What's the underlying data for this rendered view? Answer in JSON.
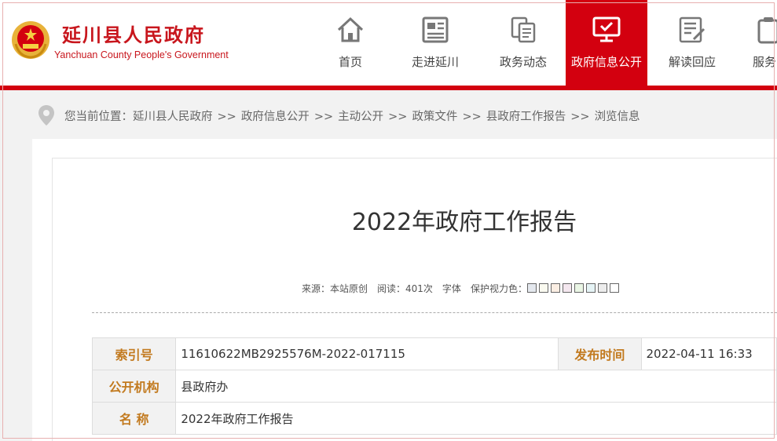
{
  "header": {
    "site_name": "延川县人民政府",
    "site_name_en": "Yanchuan County People's Government"
  },
  "nav": {
    "items": [
      {
        "label": "首页",
        "icon": "home-icon",
        "active": false
      },
      {
        "label": "走进延川",
        "icon": "newspaper-icon",
        "active": false
      },
      {
        "label": "政务动态",
        "icon": "documents-icon",
        "active": false
      },
      {
        "label": "政府信息公开",
        "icon": "monitor-icon",
        "active": true
      },
      {
        "label": "解读回应",
        "icon": "edit-document-icon",
        "active": false
      },
      {
        "label": "服务",
        "icon": "clipboard-icon",
        "active": false
      }
    ]
  },
  "breadcrumb": {
    "prefix": "您当前位置：",
    "items": [
      "延川县人民政府",
      "政府信息公开",
      "主动公开",
      "政策文件",
      "县政府工作报告",
      "浏览信息"
    ],
    "separator": ">>"
  },
  "article": {
    "title": "2022年政府工作报告",
    "meta": {
      "source": "来源：本站原创",
      "views": "阅读：401次",
      "font": "字体",
      "eye_care": "保护视力色：",
      "swatch_colors": [
        "#e4e8ee",
        "#fafaf0",
        "#fbeee3",
        "#f4e7ef",
        "#eaf6e5",
        "#e5f3f5",
        "#ececec",
        "#ffffff"
      ]
    },
    "info": {
      "index_label": "索引号",
      "index_value": "11610622MB2925576M-2022-017115",
      "date_label": "发布时间",
      "date_value": "2022-04-11 16:33",
      "org_label": "公开机构",
      "org_value": "县政府办",
      "name_label": "名 称",
      "name_value": "2022年政府工作报告"
    }
  },
  "colors": {
    "brand_red": "#d3000f",
    "label_gold": "#c27a1f"
  }
}
